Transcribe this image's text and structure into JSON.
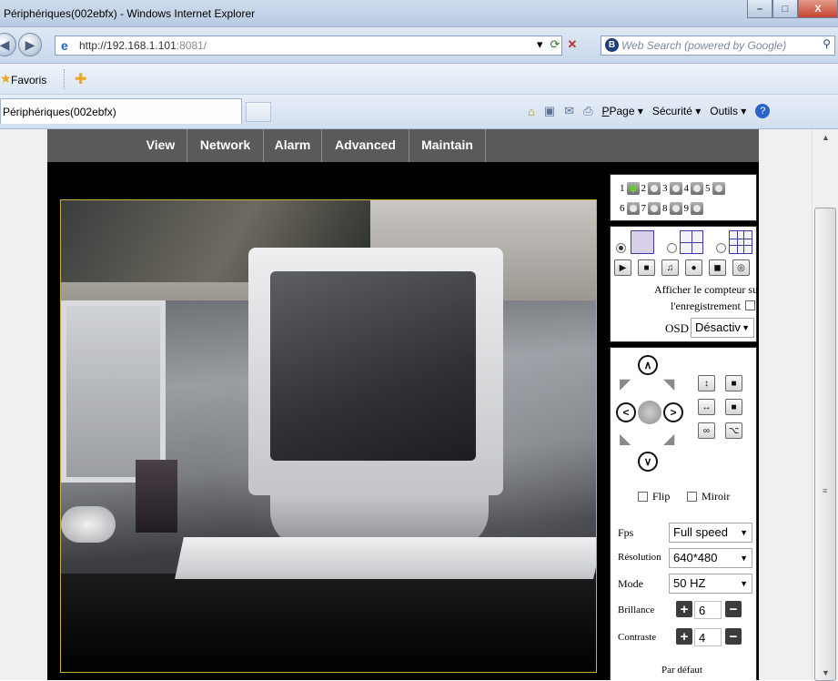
{
  "window": {
    "title": "Périphériques(002ebfx) - Windows Internet Explorer",
    "minimize": "–",
    "maximize": "□",
    "close": "X"
  },
  "addressbar": {
    "url_host": "http://192.168.1.101",
    "url_port": ":8081/",
    "search_placeholder": "Web Search (powered by Google)"
  },
  "favbar": {
    "favorites_label": "Favoris"
  },
  "tabs": [
    {
      "label": "Périphériques(002ebfx)"
    }
  ],
  "commandbar": {
    "page": "Page",
    "page_key": "P",
    "security": "Sécurité",
    "tools": "Outils",
    "tools_key": "O"
  },
  "nav": {
    "items": [
      "View",
      "Network",
      "Alarm",
      "Advanced",
      "Maintain"
    ]
  },
  "cameras": {
    "row1": [
      "1",
      "2",
      "3",
      "4",
      "5"
    ],
    "row2": [
      "6",
      "7",
      "8",
      "9"
    ],
    "active": 1
  },
  "display": {
    "counter_label_line1": "Afficher le compteur sur",
    "counter_label_line2": "l'enregistrement",
    "osd_label": "OSD",
    "osd_value": "Désactiv"
  },
  "ptz": {
    "flip_label": "Flip",
    "mirror_label": "Miroir"
  },
  "settings": {
    "fps_label": "Fps",
    "fps_value": "Full speed",
    "resolution_label": "Résolution",
    "resolution_value": "640*480",
    "mode_label": "Mode",
    "mode_value": "50 HZ",
    "brightness_label": "Brillance",
    "brightness_value": "6",
    "contrast_label": "Contraste",
    "contrast_value": "4",
    "default_label": "Par défaut"
  }
}
